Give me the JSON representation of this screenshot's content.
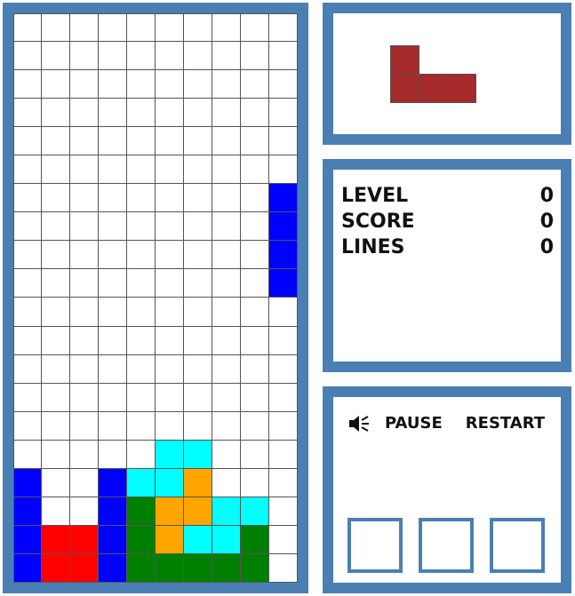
{
  "colors": {
    "frame": "#4a7fb3",
    "empty": "#ffffff",
    "grid_line": "#555555",
    "text": "#111111"
  },
  "palette": {
    "R": "#ff0000",
    "B": "#0000ff",
    "G": "#007f00",
    "O": "#ffa500",
    "C": "#00ffff",
    "D": "#a52a2a"
  },
  "board": {
    "columns": 10,
    "rows": 20,
    "cells": [
      "..........",
      "..........",
      "..........",
      "..........",
      "..........",
      "..........",
      ".........B",
      ".........B",
      ".........B",
      ".........B",
      "..........",
      "..........",
      "..........",
      "..........",
      "..........",
      ".....CC...",
      "B..BCCO...",
      "B..BGOOCC.",
      "BRRBGOCCG.",
      "BRRBGGGGG."
    ]
  },
  "next_piece": {
    "cells": [
      "D..",
      "DDD"
    ]
  },
  "stats": [
    {
      "label": "LEVEL",
      "value": "0"
    },
    {
      "label": "SCORE",
      "value": "0"
    },
    {
      "label": "LINES",
      "value": "0"
    }
  ],
  "controls": {
    "sound_icon": "speaker-icon",
    "pause_label": "PAUSE",
    "restart_label": "RESTART"
  }
}
